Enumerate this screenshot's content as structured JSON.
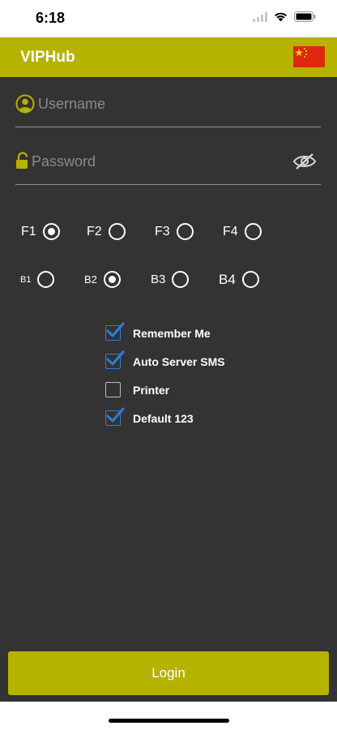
{
  "status_bar": {
    "time": "6:18"
  },
  "header": {
    "title": "VIPHub",
    "flag_icon": "china-flag-icon"
  },
  "login_form": {
    "username_placeholder": "Username",
    "password_placeholder": "Password",
    "username_value": "",
    "password_value": ""
  },
  "radio_groups": [
    {
      "options": [
        {
          "label": "F1",
          "selected": true
        },
        {
          "label": "F2",
          "selected": false
        },
        {
          "label": "F3",
          "selected": false
        },
        {
          "label": "F4",
          "selected": false
        }
      ]
    },
    {
      "options": [
        {
          "label": "B1",
          "selected": false
        },
        {
          "label": "B2",
          "selected": true
        },
        {
          "label": "B3",
          "selected": false
        },
        {
          "label": "B4",
          "selected": false
        }
      ]
    }
  ],
  "checkboxes": [
    {
      "label": "Remember Me",
      "checked": true
    },
    {
      "label": "Auto Server SMS",
      "checked": true
    },
    {
      "label": "Printer",
      "checked": false
    },
    {
      "label": "Default 123",
      "checked": true
    }
  ],
  "login_button": {
    "label": "Login"
  },
  "colors": {
    "accent": "#b5b300",
    "background": "#333333",
    "checkbox_accent": "#2f7fd6"
  }
}
